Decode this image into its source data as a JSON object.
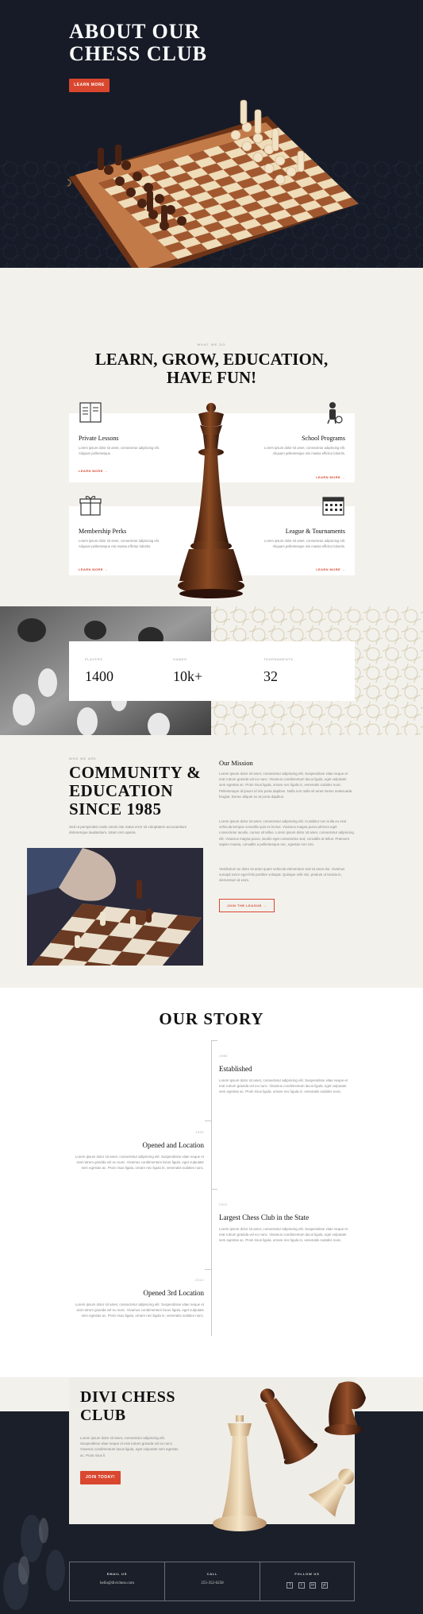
{
  "hero": {
    "title_line1": "ABOUT OUR",
    "title_line2": "CHESS CLUB",
    "button": "LEARN MORE"
  },
  "features": {
    "kicker": "WHAT WE DO",
    "title_line1": "LEARN, GROW, EDUCATION,",
    "title_line2": "HAVE FUN!",
    "cards": [
      {
        "title": "Private Lessons",
        "text": "Lorem ipsum dolor sit amet, consectetur adipiscing elit. Aliquam pellentesque",
        "link": "LEARN MORE",
        "icon": "book-icon"
      },
      {
        "title": "School Programs",
        "text": "Lorem ipsum dolor sit amet, consectetur adipiscing elit. Aliquam pellentesque nisi massa efficitur lobortis.",
        "link": "LEARN MORE",
        "icon": "student-icon"
      },
      {
        "title": "Membership Perks",
        "text": "Lorem ipsum dolor sit amet, consectetur adipiscing elit. Aliquam pellentesque nisi massa efficitur lobortis.",
        "link": "LEARN MORE",
        "icon": "gift-box-icon"
      },
      {
        "title": "League & Tournaments",
        "text": "Lorem ipsum dolor sit amet, consectetur adipiscing elit. Aliquam pellentesque nisi massa efficitur lobortis.",
        "link": "LEARN MORE",
        "icon": "calendar-icon"
      }
    ]
  },
  "stats": [
    {
      "label": "PLAYERS",
      "value": "1400"
    },
    {
      "label": "GAMES",
      "value": "10k+"
    },
    {
      "label": "TOURNAMENTS",
      "value": "32"
    }
  ],
  "community": {
    "kicker": "WHO WE ARE",
    "title_line1": "COMMUNITY &",
    "title_line2": "EDUCATION",
    "title_line3": "SINCE 1985",
    "subtitle": "Sed ut perspiciatis unde omnis iste natus error sit voluptatem accusantium doloremque laudantium, totam rem aperia.",
    "mission_title": "Our Mission",
    "p1": "Lorem ipsum dolor sit amet, consectetur adipiscing elit. Suspendisse vitae neque et erat rutrum gravida vel eu nunc. Vivamus condimentum lacus ligula, eget vulputate sem egestas ac. Proin risus ligula, ornare nec ligula in, venenatis sodales nunc. Pellentesque id ipsum id nisi porta dapibus. Nulla non nulla sit amet metus malesuada feugiat. Donec aliquet ex at porta dapibus.",
    "p2": "Lorem ipsum dolor sit amet, consectetur adipiscing elit. Curabitur non nulla eu erat vehicula tempus convallis quis ex lectus. Vivamus magna purus,ultrices eget consectetur iaculis, cursus sit tellus. Lorem ipsum dolor sit amet, consectetur adipiscing elit. Vivamus magna purus, iaculis eget consectetur sed, convallis at tellus. Praesent sapien massa, convallis a pellentesque nec, egestas non nisi.",
    "p3": "Vestibulum ac diam sit amet quam vehicula elementum sed sit amet dui. Vivamus suscipit tortor eget felis porttitor volutpat. Quisque velit nisi, pretium ut lacinia in, elementum id enim.",
    "join_button": "JOIN THE LEAGUE"
  },
  "story": {
    "title": "OUR STORY",
    "items": [
      {
        "year": "1985",
        "title": "Established",
        "text": "Lorem ipsum dolor sit amet, consectetur adipiscing elit. Suspendisse vitae neque et erat rutrum gravida vel eu nunc. Vivamus condimentum lacus ligula, eget vulputate sem egestas ac. Proin risus ligula, ornare nec ligula in, venenatis sodales nunc."
      },
      {
        "year": "1992",
        "title": "Opened and Location",
        "text": "Lorem ipsum dolor sit amet, consectetur adipiscing elit. Suspendisse vitae neque et erat rutrum gravida vel eu nunc. Vivamus condimentum lacus ligula, eget vulputate sem egestas ac. Proin risus ligula, ornare nec ligula in, venenatis sodales nunc."
      },
      {
        "year": "2001",
        "title": "Largest Chess Club in the State",
        "text": "Lorem ipsum dolor sit amet, consectetur adipiscing elit. Suspendisse vitae neque et erat rutrum gravida vel eu nunc. Vivamus condimentum lacus ligula, eget vulputate sem egestas ac. Proin risus ligula, ornare nec ligula in, venenatis sodales nunc."
      },
      {
        "year": "2010",
        "title": "Opened 3rd Location",
        "text": "Lorem ipsum dolor sit amet, consectetur adipiscing elit. Suspendisse vitae neque et erat rutrum gravida vel eu nunc. Vivamus condimentum lacus ligula, eget vulputate sem egestas ac. Proin risus ligula, ornare nec ligula in, venenatis sodales nunc."
      }
    ]
  },
  "cta": {
    "title_line1": "DIVI CHESS",
    "title_line2": "CLUB",
    "text": "Lorem ipsum dolor sit amet, consectetur adipiscing elit. Suspendisse vitae neque et erat rutrum gravida vel eu nunc. Vivamus condimentum lacus ligula, eget vulputate sem egestas ac. Proin risus li.",
    "button": "JOIN TODAY!"
  },
  "footer": {
    "email_label": "EMAIL US",
    "email_value": "hello@divichess.com",
    "call_label": "CALL",
    "call_value": "255-352-6258",
    "follow_label": "FOLLOW US",
    "social": [
      "f",
      "t",
      "in",
      "yt"
    ]
  },
  "colors": {
    "accent": "#d9472f",
    "dark": "#161b27",
    "cream": "#f3f1ec"
  }
}
